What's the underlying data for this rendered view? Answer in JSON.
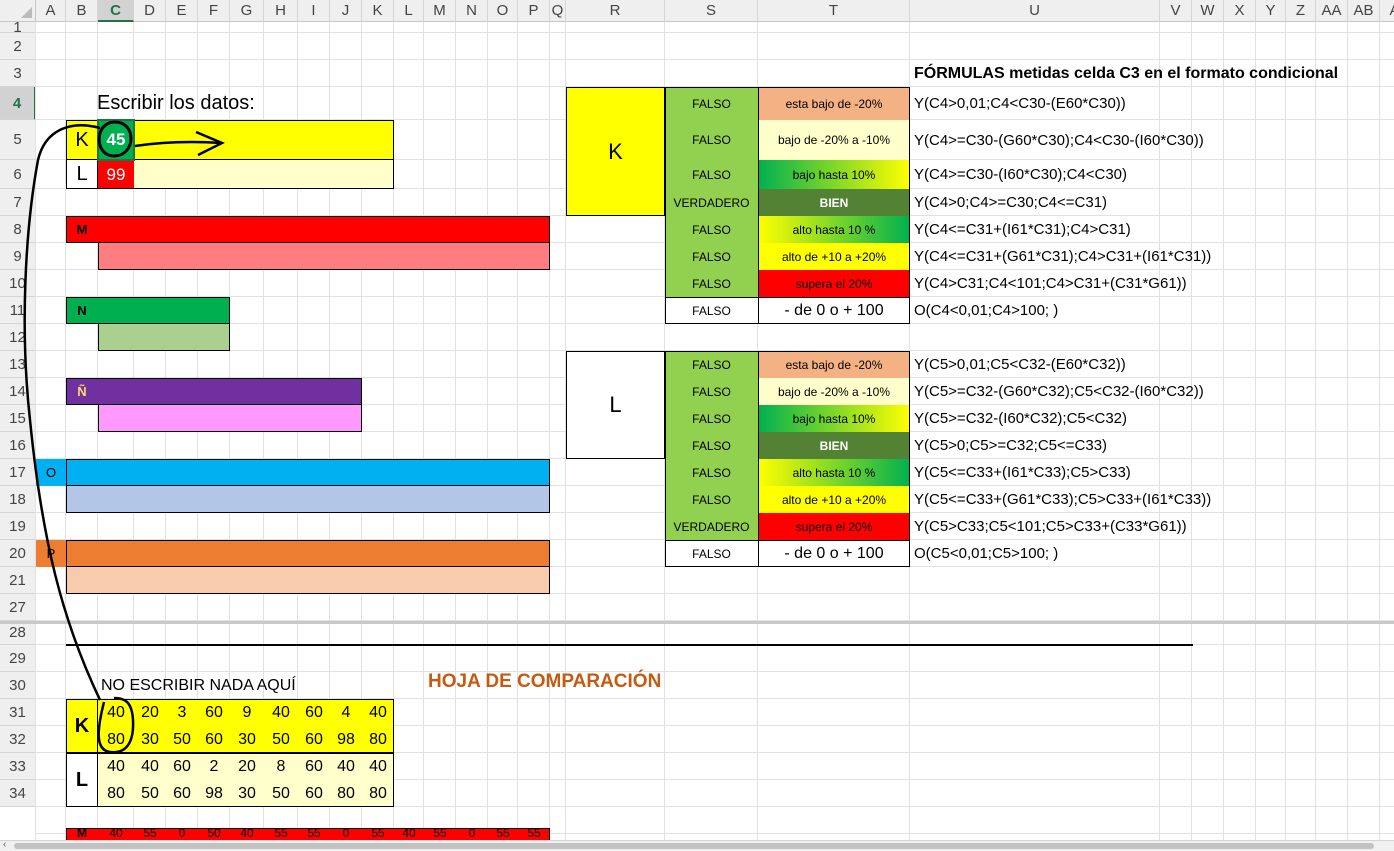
{
  "colors": {
    "yellow": "#ffff00",
    "light_yellow": "#ffffcc",
    "red": "#ff0000",
    "salmon": "#ff7c80",
    "green": "#00b050",
    "light_green": "#a9d08e",
    "purple": "#7030a0",
    "pink": "#ff99ff",
    "blue": "#00b0f0",
    "light_blue": "#b4c6e7",
    "orange": "#ed7d31",
    "peach": "#f8cbad",
    "olive_green": "#92d050",
    "dark_green": "#548235",
    "orange_text": "#c55a11"
  },
  "columns": [
    "A",
    "B",
    "C",
    "D",
    "E",
    "F",
    "G",
    "H",
    "I",
    "J",
    "K",
    "L",
    "M",
    "N",
    "O",
    "P",
    "Q",
    "R",
    "S",
    "T",
    "U",
    "V",
    "W",
    "X",
    "Y",
    "Z",
    "AA",
    "AB",
    "A"
  ],
  "rows": [
    "1",
    "2",
    "3",
    "4",
    "5",
    "6",
    "7",
    "8",
    "9",
    "10",
    "11",
    "12",
    "13",
    "14",
    "15",
    "16",
    "17",
    "18",
    "19",
    "20",
    "21",
    "27",
    "28",
    "29",
    "30",
    "31",
    "32",
    "33",
    "34"
  ],
  "input_block": {
    "title": "Escribir los datos:",
    "k_label": "K",
    "k_value": "45",
    "l_label": "L",
    "l_value": "99"
  },
  "bars": {
    "m_label": "M",
    "n_label": "N",
    "enye_label": "Ñ",
    "o_label": "O",
    "p_label": "P"
  },
  "formulas_title": "FÓRMULAS metidas celda C3 en el formato condicional",
  "k_table": {
    "label": "K",
    "rows": [
      {
        "result": "FALSO",
        "desc": "esta bajo de -20%",
        "formula": "Y(C4>0,01;C4<C30-(E60*C30))"
      },
      {
        "result": "FALSO",
        "desc": "bajo de -20% a -10%",
        "formula": "Y(C4>=C30-(G60*C30);C4<C30-(I60*C30))"
      },
      {
        "result": "FALSO",
        "desc": "bajo hasta 10%",
        "formula": "Y(C4>=C30-(I60*C30);C4<C30)"
      },
      {
        "result": "VERDADERO",
        "desc": "BIEN",
        "formula": "Y(C4>0;C4>=C30;C4<=C31)"
      },
      {
        "result": "FALSO",
        "desc": "alto hasta 10 %",
        "formula": "Y(C4<=C31+(I61*C31);C4>C31)"
      },
      {
        "result": "FALSO",
        "desc": "alto de +10 a +20%",
        "formula": "Y(C4<=C31+(G61*C31);C4>C31+(I61*C31))"
      },
      {
        "result": "FALSO",
        "desc": "supera el 20%",
        "formula": "Y(C4>C31;C4<101;C4>C31+(C31*G61))"
      },
      {
        "result": "FALSO",
        "desc": "- de 0 o + 100",
        "formula": "O(C4<0,01;C4>100; )"
      }
    ]
  },
  "l_table": {
    "label": "L",
    "rows": [
      {
        "result": "FALSO",
        "desc": "esta bajo de -20%",
        "formula": "Y(C5>0,01;C5<C32-(E60*C32))"
      },
      {
        "result": "FALSO",
        "desc": "bajo de -20% a -10%",
        "formula": "Y(C5>=C32-(G60*C32);C5<C32-(I60*C32))"
      },
      {
        "result": "FALSO",
        "desc": "bajo hasta 10%",
        "formula": "Y(C5>=C32-(I60*C32);C5<C32)"
      },
      {
        "result": "FALSO",
        "desc": "BIEN",
        "formula": "Y(C5>0;C5>=C32;C5<=C33)"
      },
      {
        "result": "FALSO",
        "desc": "alto hasta 10 %",
        "formula": "Y(C5<=C33+(I61*C33);C5>C33)"
      },
      {
        "result": "FALSO",
        "desc": "alto de +10 a +20%",
        "formula": "Y(C5<=C33+(G61*C33);C5>C33+(I61*C33))"
      },
      {
        "result": "VERDADERO",
        "desc": "supera el 20%",
        "formula": "Y(C5>C33;C5<101;C5>C33+(C33*G61))"
      },
      {
        "result": "FALSO",
        "desc": "- de 0 o + 100",
        "formula": "O(C5<0,01;C5>100; )"
      }
    ]
  },
  "comparison": {
    "note": "NO ESCRIBIR NADA AQUÍ",
    "title": "HOJA  DE COMPARACIÓN",
    "k_label": "K",
    "l_label": "L",
    "row30": [
      "40",
      "20",
      "3",
      "60",
      "9",
      "40",
      "60",
      "4",
      "40"
    ],
    "row31": [
      "80",
      "30",
      "50",
      "60",
      "30",
      "50",
      "60",
      "98",
      "80"
    ],
    "row32": [
      "40",
      "40",
      "60",
      "2",
      "20",
      "8",
      "60",
      "40",
      "40"
    ],
    "row33": [
      "80",
      "50",
      "60",
      "98",
      "30",
      "50",
      "60",
      "80",
      "80"
    ],
    "row35_label": "M",
    "row35": [
      "40",
      "55",
      "0",
      "50",
      "40",
      "55",
      "55",
      "0",
      "55",
      "40",
      "55",
      "0",
      "55",
      "55"
    ]
  }
}
